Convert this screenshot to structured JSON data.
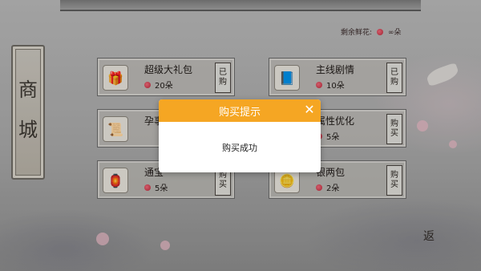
{
  "header": {
    "remaining_label": "剩余鲜花:",
    "remaining_value": "∞朵"
  },
  "sidebar": {
    "title_chars": [
      "商",
      "城"
    ]
  },
  "items": [
    {
      "name": "超级大礼包",
      "price": "20朵",
      "status": "已购",
      "icon": "gift-bag-icon"
    },
    {
      "name": "主线剧情",
      "price": "10朵",
      "status": "已购",
      "icon": "book-icon"
    },
    {
      "name": "孕事",
      "price": "",
      "status": "",
      "icon": "scroll-icon"
    },
    {
      "name": "属性优化",
      "price": "5朵",
      "status": "购买",
      "icon": ""
    },
    {
      "name": "通宝",
      "price": "5朵",
      "status": "购买",
      "icon": "coin-icon"
    },
    {
      "name": "银两包",
      "price": "2朵",
      "status": "购买",
      "icon": "silver-icon"
    }
  ],
  "dialog": {
    "title": "购买提示",
    "message": "购买成功"
  },
  "footer": {
    "back_label": "返"
  },
  "colors": {
    "dialog_header": "#f5a623",
    "flower": "#d43a4c"
  }
}
